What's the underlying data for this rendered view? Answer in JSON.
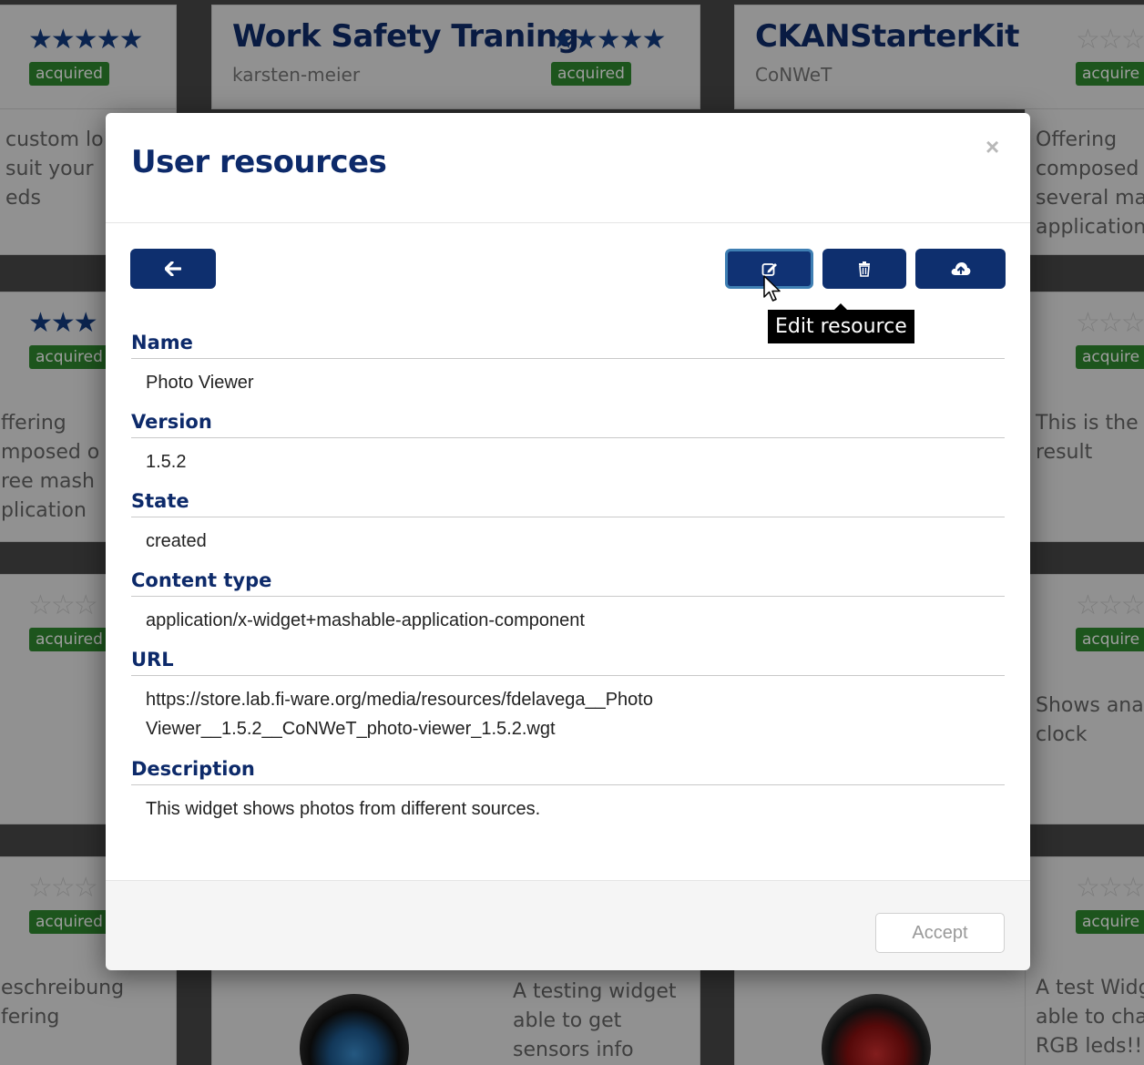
{
  "background": {
    "cards": [
      {
        "title": "",
        "owner": "",
        "stars": "★★★★★",
        "stars_kind": "full",
        "badge": "acquired",
        "desc": ""
      },
      {
        "title": "Work Safety Traning",
        "owner": "karsten-meier",
        "stars": "",
        "stars_kind": "",
        "badge": "",
        "desc": ""
      },
      {
        "title": "",
        "owner": "",
        "stars": "★★★★★",
        "stars_kind": "full",
        "badge": "acquired",
        "desc": ""
      },
      {
        "title": "CKANStarterKit",
        "owner": "CoNWeT",
        "stars": "",
        "stars_kind": "",
        "badge": "",
        "desc": ""
      },
      {
        "title": "",
        "owner": "",
        "stars": "☆☆☆",
        "stars_kind": "empty",
        "badge": "acquire",
        "desc": ""
      }
    ],
    "side_texts": {
      "left_1": "custom lo\nsuit your\neds",
      "right_1": "Offering\ncomposed\nseveral ma\napplication",
      "left_2": "ffering\nmposed o\nree mash\nplication",
      "right_2": "This is the f\nresult",
      "right_3": "Shows anal\nclock",
      "left_4": "eschreibung\nfering",
      "bottom_mid": "A testing widget\nable to get\nsensors info",
      "right_4": "A test Widg\nable to cha\nRGB leds!!!"
    },
    "left_stars": [
      "★★★",
      "☆☆☆",
      "☆☆☆"
    ],
    "left_badge": "acquired",
    "right_stars": "☆☆☆",
    "right_badge": "acquire"
  },
  "modal": {
    "title": "User resources",
    "close_symbol": "×",
    "tooltip": "Edit resource",
    "fields": [
      {
        "label": "Name",
        "value": "Photo Viewer"
      },
      {
        "label": "Version",
        "value": "1.5.2"
      },
      {
        "label": "State",
        "value": "created"
      },
      {
        "label": "Content type",
        "value": "application/x-widget+mashable-application-component"
      },
      {
        "label": "URL",
        "value": "https://store.lab.fi-ware.org/media/resources/fdelavega__Photo\nViewer__1.5.2__CoNWeT_photo-viewer_1.5.2.wgt"
      },
      {
        "label": "Description",
        "value": "This widget shows photos from different sources."
      }
    ],
    "accept_label": "Accept",
    "toolbar_icons": [
      "arrow-left-icon",
      "edit-icon",
      "trash-icon",
      "cloud-upload-icon"
    ]
  },
  "colors": {
    "primary": "#0e2f6e",
    "heading": "#0d2a6a",
    "badge_green": "#2f8a2f"
  }
}
